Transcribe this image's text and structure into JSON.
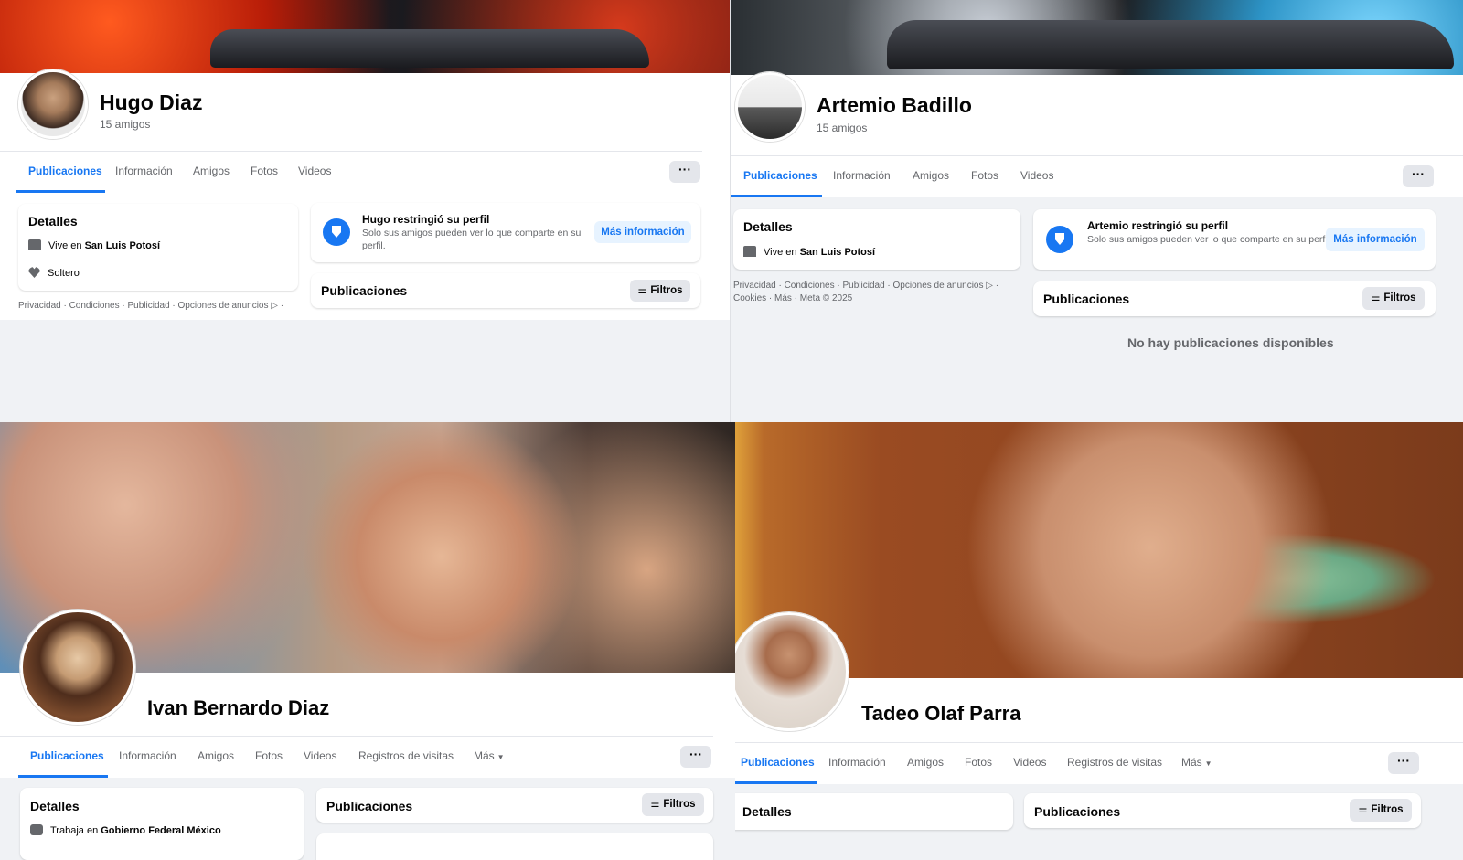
{
  "profiles": [
    {
      "name": "Hugo Diaz",
      "friends": "15 amigos",
      "tabs": [
        "Publicaciones",
        "Información",
        "Amigos",
        "Fotos",
        "Videos"
      ],
      "more_icon": "···",
      "details_title": "Detalles",
      "lives_prefix": "Vive en ",
      "lives_city": "San Luis Potosí",
      "relationship": "Soltero",
      "restrict_title": "Hugo restringió su perfil",
      "restrict_text": "Solo sus amigos pueden ver lo que comparte en su perfil.",
      "more_info": "Más información",
      "posts_title": "Publicaciones",
      "filters": "Filtros",
      "footer": "Privacidad · Condiciones · Publicidad · Opciones de anuncios ▷ ·"
    },
    {
      "name": "Artemio Badillo",
      "friends": "15 amigos",
      "tabs": [
        "Publicaciones",
        "Información",
        "Amigos",
        "Fotos",
        "Videos"
      ],
      "more_icon": "···",
      "details_title": "Detalles",
      "lives_prefix": "Vive en ",
      "lives_city": "San Luis Potosí",
      "restrict_title": "Artemio restringió su perfil",
      "restrict_text": "Solo sus amigos pueden ver lo que comparte en su perfil.",
      "more_info": "Más información",
      "posts_title": "Publicaciones",
      "filters": "Filtros",
      "footer_line1": "Privacidad · Condiciones · Publicidad · Opciones de anuncios ▷ ·",
      "footer_line2": "Cookies · Más · Meta © 2025",
      "empty": "No hay publicaciones disponibles"
    },
    {
      "name": "Ivan Bernardo Diaz",
      "tabs": [
        "Publicaciones",
        "Información",
        "Amigos",
        "Fotos",
        "Videos",
        "Registros de visitas",
        "Más"
      ],
      "more_icon": "···",
      "details_title": "Detalles",
      "work_prefix": "Trabaja en ",
      "work_place": "Gobierno Federal México",
      "posts_title": "Publicaciones",
      "filters": "Filtros"
    },
    {
      "name": "Tadeo Olaf Parra",
      "tabs": [
        "Publicaciones",
        "Información",
        "Amigos",
        "Fotos",
        "Videos",
        "Registros de visitas",
        "Más"
      ],
      "more_icon": "···",
      "details_title": "Detalles",
      "posts_title": "Publicaciones",
      "filters": "Filtros"
    }
  ],
  "colors": {
    "accent": "#1877f2",
    "background": "#f0f2f5",
    "secondary_text": "#65676b"
  },
  "icons": [
    "shield-icon",
    "home-icon",
    "heart-icon",
    "briefcase-icon",
    "filter-icon",
    "caret-down-icon",
    "ellipsis-icon"
  ]
}
